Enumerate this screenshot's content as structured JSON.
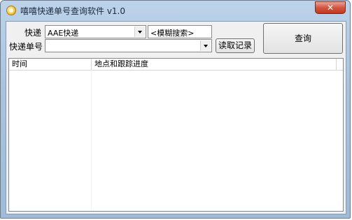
{
  "window": {
    "title": "嘻嘻快递单号查询软件 v1.0",
    "close_glyph": "✕"
  },
  "form": {
    "courier_label": "快递",
    "courier_value": "AAE快递",
    "fuzzy_search": "<模糊搜索>",
    "tracking_label": "快递单号",
    "tracking_value": "",
    "read_record_button": "读取记录",
    "query_button": "查询"
  },
  "list": {
    "columns": [
      "时间",
      "地点和跟踪进度"
    ]
  }
}
